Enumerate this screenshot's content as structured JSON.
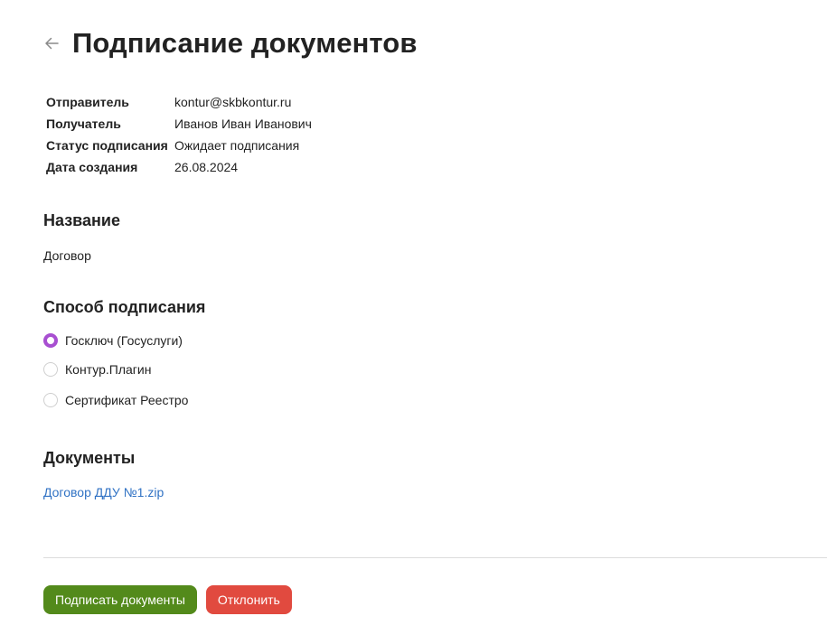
{
  "header": {
    "title": "Подписание документов",
    "back_icon": "arrow-left-icon"
  },
  "info": [
    {
      "label": "Отправитель",
      "value": "kontur@skbkontur.ru"
    },
    {
      "label": "Получатель",
      "value": "Иванов Иван Иванович"
    },
    {
      "label": "Статус подписания",
      "value": "Ожидает подписания"
    },
    {
      "label": "Дата создания",
      "value": "26.08.2024"
    }
  ],
  "name_section": {
    "title": "Название",
    "value": "Договор"
  },
  "signing_method": {
    "title": "Способ подписания",
    "options": [
      {
        "label": "Госключ (Госуслуги)",
        "checked": true
      },
      {
        "label": "Контур.Плагин",
        "checked": false
      },
      {
        "label": "Сертификат Реестро",
        "checked": false
      }
    ],
    "accent_color": "#a84fd1"
  },
  "documents": {
    "title": "Документы",
    "files": [
      {
        "name": "Договор ДДУ №1.zip"
      }
    ]
  },
  "actions": {
    "sign_label": "Подписать документы",
    "sign_color": "#538a1b",
    "reject_label": "Отклонить",
    "reject_color": "#e14a3f"
  }
}
